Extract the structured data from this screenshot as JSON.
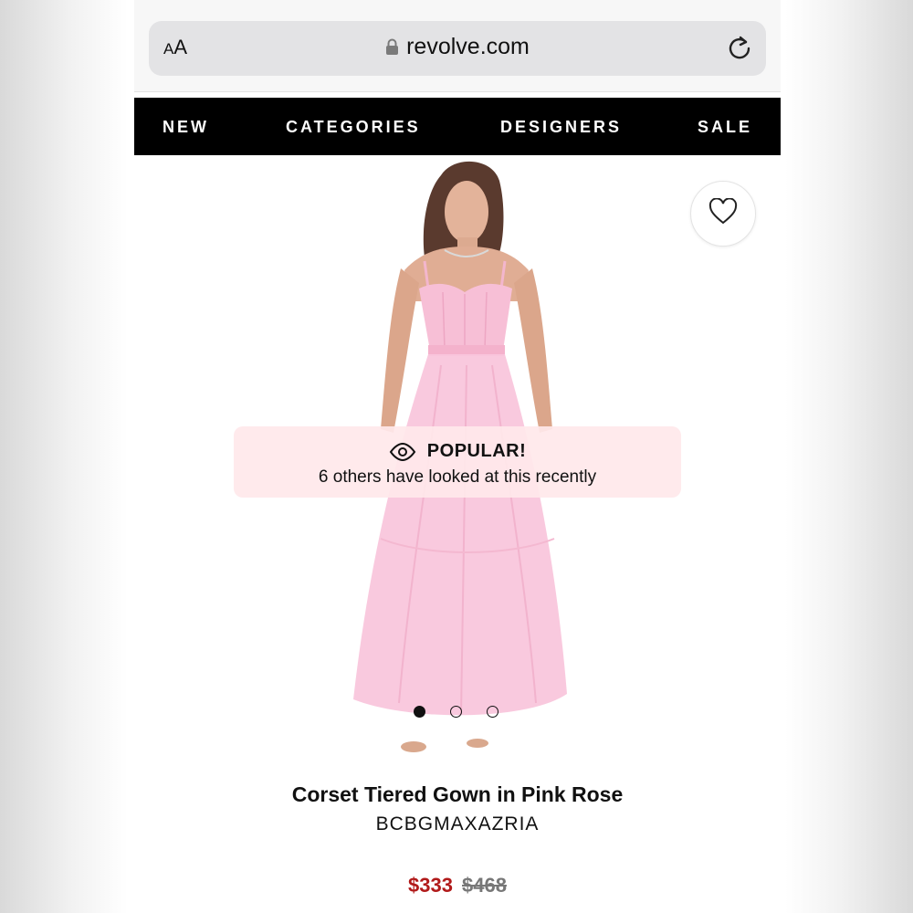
{
  "browser": {
    "aa_label_small": "A",
    "aa_label_large": "A",
    "url": "revolve.com"
  },
  "nav": {
    "items": [
      "NEW",
      "CATEGORIES",
      "DESIGNERS",
      "SALE"
    ]
  },
  "product": {
    "popular_title": "POPULAR!",
    "popular_subtitle": "6 others have looked at this recently",
    "name": "Corset Tiered Gown in Pink Rose",
    "brand": "BCBGMAXAZRIA",
    "sale_price": "$333",
    "original_price": "$468",
    "carousel_active_index": 0,
    "carousel_count": 3
  },
  "colors": {
    "nav_bg": "#000000",
    "sale_price": "#b11a1a",
    "dress_pink": "#f9c6dc",
    "banner_bg": "#ffe8ea"
  },
  "icons": {
    "lock": "lock-icon",
    "reload": "reload-icon",
    "wishlist": "heart-icon",
    "popular": "eye-icon"
  }
}
